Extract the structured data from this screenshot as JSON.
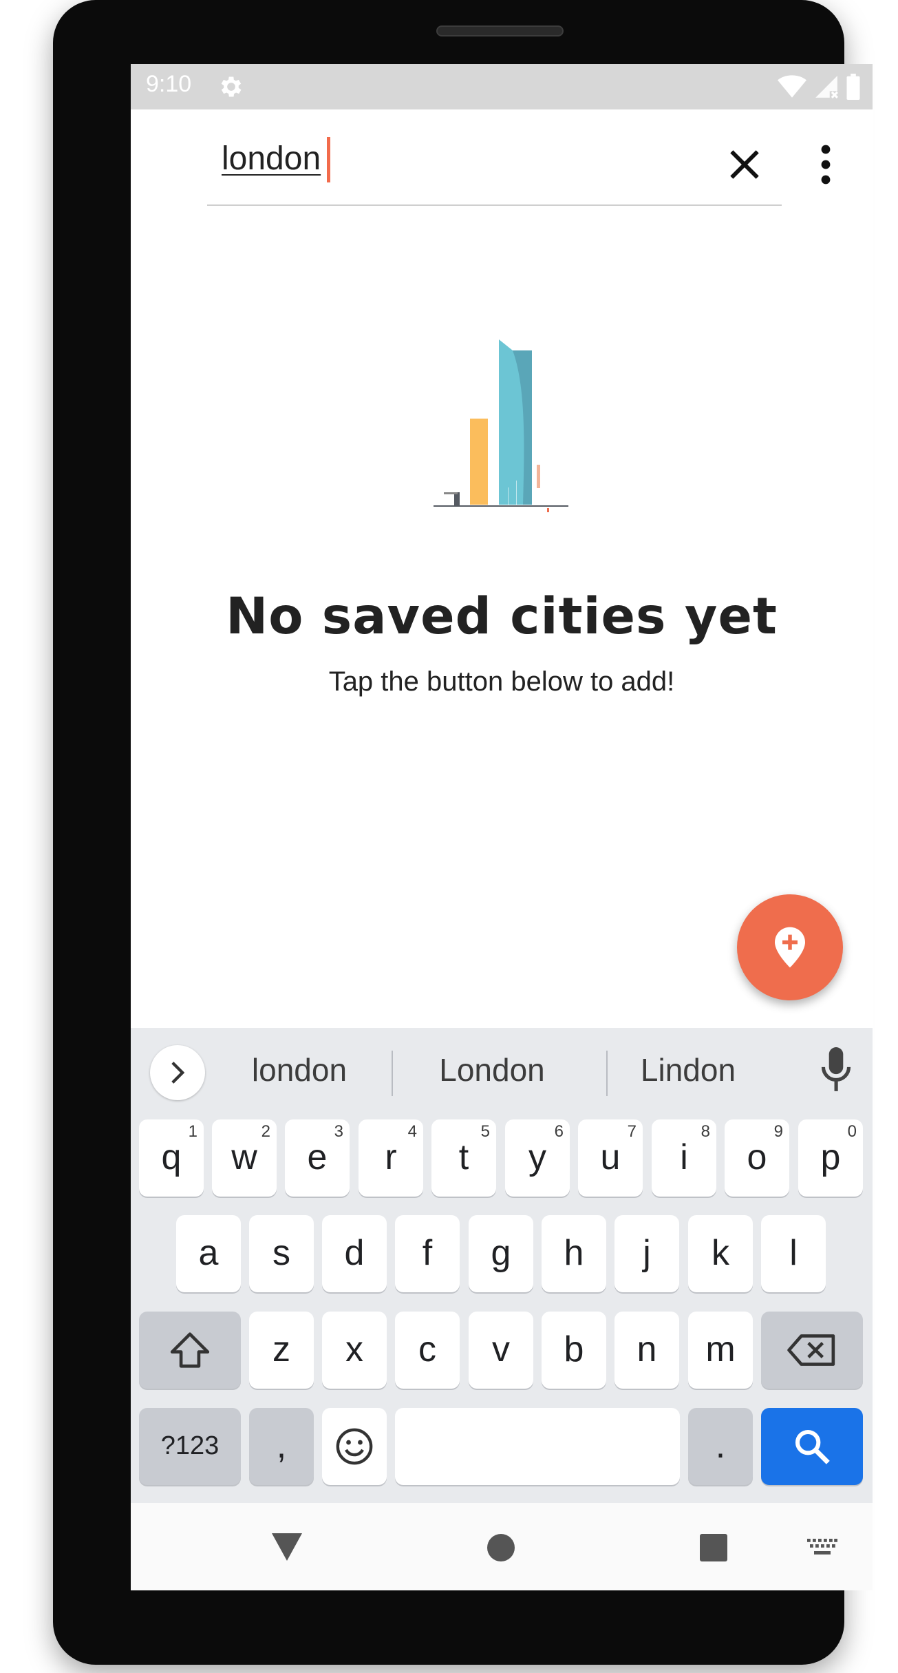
{
  "status_bar": {
    "time": "9:10",
    "icons": [
      "settings-icon",
      "wifi-icon",
      "signal-off-icon",
      "battery-icon"
    ]
  },
  "search": {
    "value": "london",
    "clear_icon": "close-icon",
    "menu_icon": "more-vert-icon"
  },
  "empty_state": {
    "title": "No saved cities yet",
    "subtitle": "Tap the button below to add!",
    "illustration": "city-buildings-illustration"
  },
  "fab": {
    "icon": "add-location-icon",
    "color": "#ef6d4d"
  },
  "keyboard": {
    "suggestions": [
      "london",
      "London",
      "Lindon"
    ],
    "row1": [
      {
        "label": "q",
        "hint": "1"
      },
      {
        "label": "w",
        "hint": "2"
      },
      {
        "label": "e",
        "hint": "3"
      },
      {
        "label": "r",
        "hint": "4"
      },
      {
        "label": "t",
        "hint": "5"
      },
      {
        "label": "y",
        "hint": "6"
      },
      {
        "label": "u",
        "hint": "7"
      },
      {
        "label": "i",
        "hint": "8"
      },
      {
        "label": "o",
        "hint": "9"
      },
      {
        "label": "p",
        "hint": "0"
      }
    ],
    "row2": [
      "a",
      "s",
      "d",
      "f",
      "g",
      "h",
      "j",
      "k",
      "l"
    ],
    "row3": [
      "z",
      "x",
      "c",
      "v",
      "b",
      "n",
      "m"
    ],
    "symbols_label": "?123",
    "comma_label": ",",
    "period_label": ".",
    "accent_color": "#1a73e8"
  },
  "nav_bar": {
    "icons": [
      "back-triangle-icon",
      "home-circle-icon",
      "recents-square-icon",
      "keyboard-switch-icon"
    ]
  }
}
